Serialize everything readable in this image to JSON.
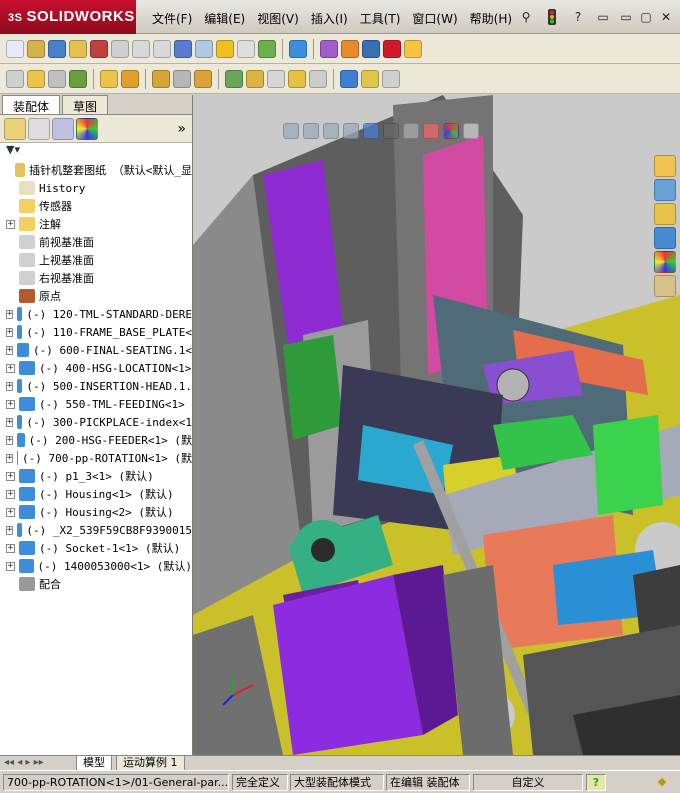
{
  "app": {
    "logo": "SOLIDWORKS",
    "logo_prefix": "3S"
  },
  "menu": [
    "文件(F)",
    "编辑(E)",
    "视图(V)",
    "插入(I)",
    "工具(T)",
    "窗口(W)",
    "帮助(H)"
  ],
  "window_controls": {
    "help": "?",
    "minimize": "▭",
    "restore": "▢",
    "close": "✕"
  },
  "panel": {
    "tabs": [
      "装配体",
      "草图"
    ],
    "root": "插针机整套图纸 （默认<默认_显",
    "items": [
      {
        "label": "History",
        "icon": "history-icon",
        "expandable": false
      },
      {
        "label": "传感器",
        "icon": "sensor-icon",
        "expandable": false
      },
      {
        "label": "注解",
        "icon": "annotation-icon",
        "expandable": true
      },
      {
        "label": "前视基准面",
        "icon": "plane-icon",
        "expandable": false
      },
      {
        "label": "上视基准面",
        "icon": "plane-icon",
        "expandable": false
      },
      {
        "label": "右视基准面",
        "icon": "plane-icon",
        "expandable": false
      },
      {
        "label": "原点",
        "icon": "origin-icon",
        "expandable": false
      },
      {
        "label": "(-) 120-TML-STANDARD-DERE",
        "icon": "assembly-icon",
        "expandable": true
      },
      {
        "label": "(-) 110-FRAME_BASE_PLATE<",
        "icon": "assembly-icon",
        "expandable": true
      },
      {
        "label": "(-) 600-FINAL-SEATING.1<",
        "icon": "assembly-icon",
        "expandable": true
      },
      {
        "label": "(-) 400-HSG-LOCATION<1>",
        "icon": "assembly-icon",
        "expandable": true
      },
      {
        "label": "(-) 500-INSERTION-HEAD.1.",
        "icon": "assembly-icon",
        "expandable": true
      },
      {
        "label": "(-) 550-TML-FEEDING<1>",
        "icon": "assembly-icon",
        "expandable": true
      },
      {
        "label": "(-) 300-PICKPLACE-index<1",
        "icon": "assembly-icon",
        "expandable": true
      },
      {
        "label": "(-) 200-HSG-FEEDER<1> (默",
        "icon": "assembly-icon",
        "expandable": true
      },
      {
        "label": "(-) 700-pp-ROTATION<1> (默",
        "icon": "assembly-icon",
        "expandable": true
      },
      {
        "label": "(-) p1_3<1> (默认)",
        "icon": "assembly-icon",
        "expandable": true
      },
      {
        "label": "(-) Housing<1> (默认)",
        "icon": "assembly-icon",
        "expandable": true
      },
      {
        "label": "(-) Housing<2> (默认)",
        "icon": "assembly-icon",
        "expandable": true
      },
      {
        "label": "(-) _X2_539F59CB8F9390015",
        "icon": "assembly-icon",
        "expandable": true
      },
      {
        "label": "(-) Socket-1<1> (默认)",
        "icon": "assembly-icon",
        "expandable": true
      },
      {
        "label": "(-) 1400053000<1> (默认)",
        "icon": "assembly-icon",
        "expandable": true
      },
      {
        "label": "配合",
        "icon": "mates-icon",
        "expandable": false
      }
    ]
  },
  "bottom_tabs": [
    "模型",
    "运动算例 1"
  ],
  "status": {
    "path": "700-pp-ROTATION<1>/01-General-par...",
    "fully_defined": "完全定义",
    "large_mode": "大型装配体模式",
    "editing": "在编辑 装配体",
    "custom": "自定义",
    "help": "?"
  },
  "colors": {
    "logo_red": "#c8102e",
    "viewport_bg": "#c9c9c9",
    "accent_yellow": "#c9c02a"
  }
}
